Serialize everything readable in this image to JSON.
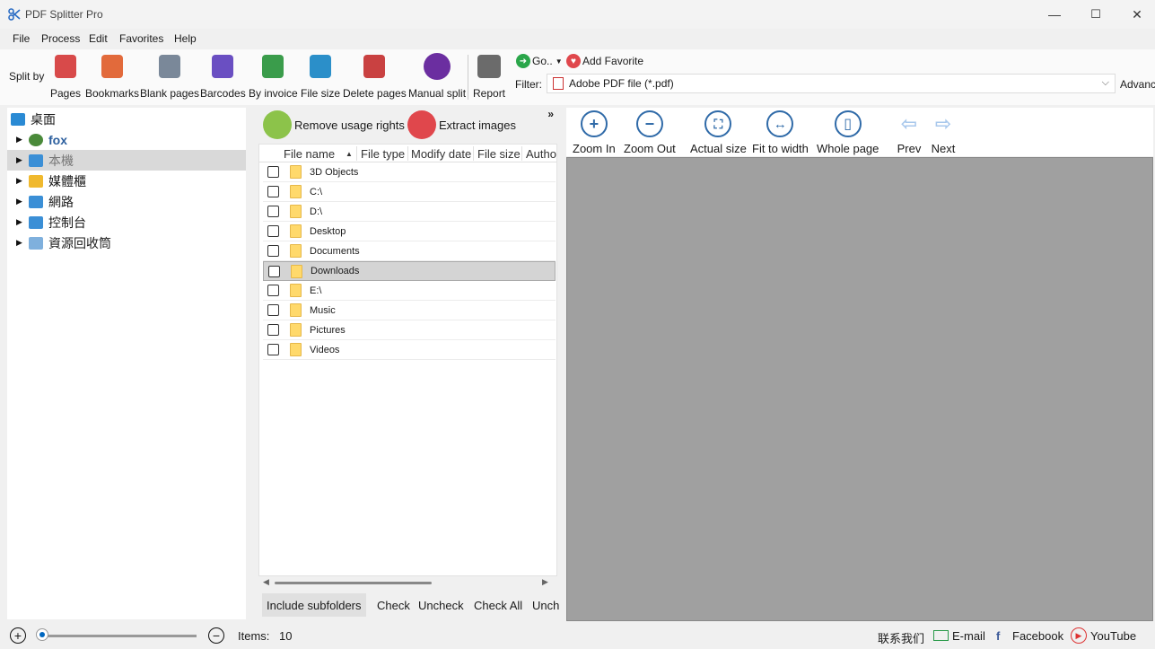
{
  "window": {
    "title": "PDF Splitter Pro",
    "minimize": "—",
    "maximize": "☐",
    "close": "✕"
  },
  "menu": {
    "items": [
      "File",
      "Process",
      "Edit",
      "Favorites",
      "Help"
    ]
  },
  "toolbar": {
    "split_by": "Split by",
    "buttons": [
      {
        "label": "Pages",
        "icon": "pages-icon",
        "color": "#d84a4a"
      },
      {
        "label": "Bookmarks",
        "icon": "bookmark-icon",
        "color": "#e26a3b"
      },
      {
        "label": "Blank pages",
        "icon": "blank-page-icon",
        "color": "#7a8899"
      },
      {
        "label": "Barcodes",
        "icon": "barcode-icon",
        "color": "#6a4fc2"
      },
      {
        "label": "By invoice",
        "icon": "invoice-icon",
        "color": "#3a9c4b"
      },
      {
        "label": "File size",
        "icon": "file-size-icon",
        "color": "#2b8fc9"
      },
      {
        "label": "Delete pages",
        "icon": "delete-pages-icon",
        "color": "#c94141"
      },
      {
        "label": "Manual split",
        "icon": "manual-split-icon",
        "color": "#6b2ea0"
      },
      {
        "label": "Report",
        "icon": "report-icon",
        "color": "#6b6b6b"
      }
    ],
    "go_label": "Go..",
    "add_favorite": "Add Favorite",
    "filter_label": "Filter:",
    "filter_value": "Adobe PDF file (*.pdf)",
    "advanced": "Advanc"
  },
  "tree": {
    "items": [
      {
        "label": "桌面",
        "icon": "desktop-icon",
        "color": "#2a8ad4",
        "arrow": ""
      },
      {
        "label": "fox",
        "icon": "user-icon",
        "color": "#4a8a3a",
        "arrow": "▶"
      },
      {
        "label": "本機",
        "icon": "computer-icon",
        "color": "#3b8fd6",
        "arrow": "▶"
      },
      {
        "label": "媒體櫃",
        "icon": "library-icon",
        "color": "#f0b92e",
        "arrow": "▶"
      },
      {
        "label": "網路",
        "icon": "network-icon",
        "color": "#3b8fd6",
        "arrow": "▶"
      },
      {
        "label": "控制台",
        "icon": "control-panel-icon",
        "color": "#3b8fd6",
        "arrow": "▶"
      },
      {
        "label": "資源回收筒",
        "icon": "recycle-bin-icon",
        "color": "#7fb0dd",
        "arrow": "▶"
      }
    ]
  },
  "files": {
    "remove_rights": "Remove usage rights",
    "extract_images": "Extract images",
    "more": "»",
    "columns": [
      "File name",
      "File type",
      "Modify date",
      "File size",
      "Autho"
    ],
    "sort_indicator": "▲",
    "rows": [
      "3D Objects",
      "C:\\",
      "D:\\",
      "Desktop",
      "Documents",
      "Downloads",
      "E:\\",
      "Music",
      "Pictures",
      "Videos"
    ],
    "selected_row": "Downloads",
    "include_subfolders": "Include subfolders",
    "check": "Check",
    "uncheck": "Uncheck",
    "check_all": "Check All",
    "uncheck_all": "Unch"
  },
  "viewer": {
    "buttons": [
      {
        "label": "Zoom In",
        "glyph": "+"
      },
      {
        "label": "Zoom Out",
        "glyph": "−"
      },
      {
        "label": "Actual size",
        "glyph": "⛶"
      },
      {
        "label": "Fit to width",
        "glyph": "↔"
      },
      {
        "label": "Whole page",
        "glyph": "▯"
      },
      {
        "label": "Prev",
        "glyph": "⇦"
      },
      {
        "label": "Next",
        "glyph": "⇨"
      }
    ]
  },
  "status": {
    "zoom_in": "+",
    "zoom_out": "−",
    "items_label": "Items:",
    "items_count": "10",
    "contact": "联系我们",
    "email": "E-mail",
    "facebook": "Facebook",
    "youtube": "YouTube"
  }
}
